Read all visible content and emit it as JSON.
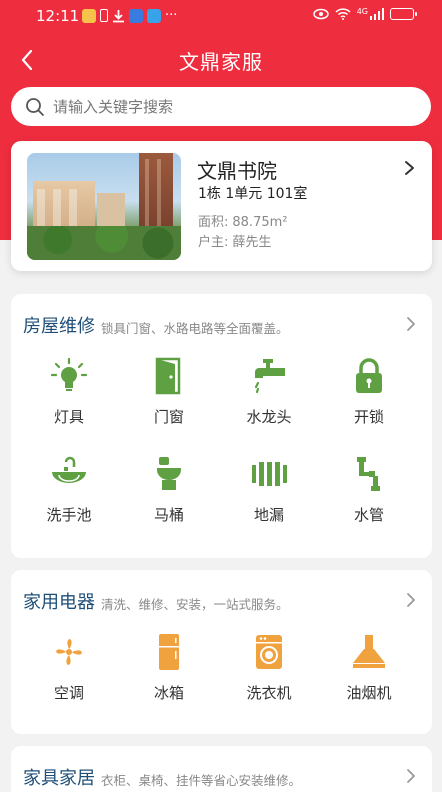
{
  "status_bar": {
    "time": "12:11",
    "dots": "···",
    "network": "4G"
  },
  "nav": {
    "title": "文鼎家服"
  },
  "search": {
    "placeholder": "请输入关键字搜索"
  },
  "house": {
    "name": "文鼎书院",
    "unit": "1栋 1单元 101室",
    "area_label": "面积:",
    "area_value": "88.75m²",
    "owner_label": "户主:",
    "owner_value": "薛先生"
  },
  "sections": [
    {
      "title": "房屋维修",
      "desc": "锁具门窗、水路电路等全面覆盖。",
      "color": "#5fa043",
      "items": [
        {
          "label": "灯具",
          "icon": "lightbulb-icon"
        },
        {
          "label": "门窗",
          "icon": "door-icon"
        },
        {
          "label": "水龙头",
          "icon": "faucet-icon"
        },
        {
          "label": "开锁",
          "icon": "lock-icon"
        },
        {
          "label": "洗手池",
          "icon": "sink-icon"
        },
        {
          "label": "马桶",
          "icon": "toilet-icon"
        },
        {
          "label": "地漏",
          "icon": "floor-drain-icon"
        },
        {
          "label": "水管",
          "icon": "water-pipe-icon"
        }
      ]
    },
    {
      "title": "家用电器",
      "desc": "清洗、维修、安装，一站式服务。",
      "color": "#f0a23e",
      "items": [
        {
          "label": "空调",
          "icon": "air-conditioner-icon"
        },
        {
          "label": "冰箱",
          "icon": "refrigerator-icon"
        },
        {
          "label": "洗衣机",
          "icon": "washing-machine-icon"
        },
        {
          "label": "油烟机",
          "icon": "range-hood-icon"
        }
      ]
    },
    {
      "title": "家具家居",
      "desc": "衣柜、桌椅、挂件等省心安装维修。",
      "color": "#1f4f78",
      "items": []
    }
  ],
  "colors": {
    "brand_red": "#ee2d3f",
    "repair_green": "#5fa043",
    "appliance_orange": "#f0a23e",
    "title_blue": "#1f4f78"
  }
}
